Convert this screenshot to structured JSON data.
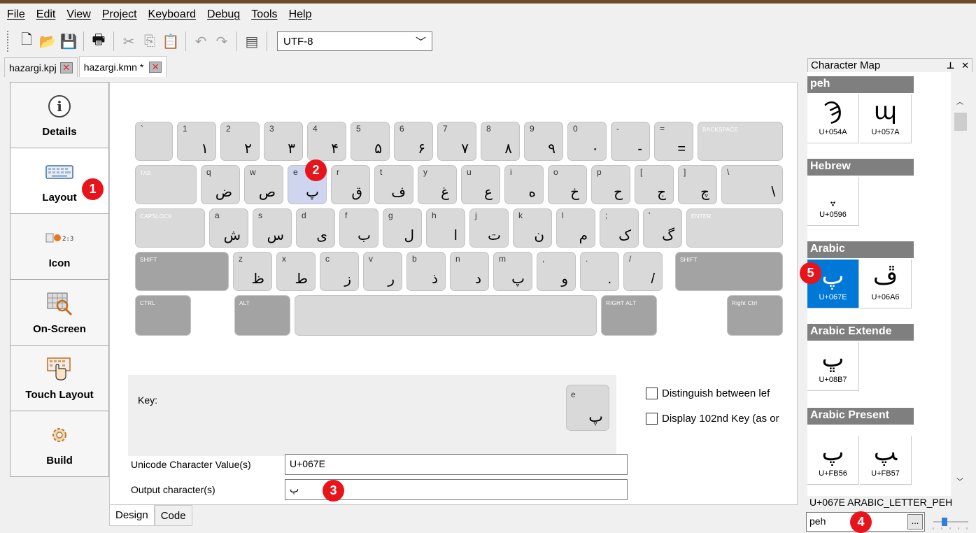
{
  "menu": [
    "File",
    "Edit",
    "View",
    "Project",
    "Keyboard",
    "Debug",
    "Tools",
    "Help"
  ],
  "toolbar": {
    "encoding": "UTF-8"
  },
  "tabs": [
    {
      "label": "hazargi.kpj",
      "active": false
    },
    {
      "label": "hazargi.kmn *",
      "active": true
    }
  ],
  "nav": [
    {
      "label": "Details",
      "icon": "info-icon"
    },
    {
      "label": "Layout",
      "icon": "keyboard-icon"
    },
    {
      "label": "Icon",
      "icon": "icon-editor-icon"
    },
    {
      "label": "On-Screen",
      "icon": "onscreen-keyboard-icon"
    },
    {
      "label": "Touch Layout",
      "icon": "touch-layout-icon"
    },
    {
      "label": "Build",
      "icon": "gear-icon"
    }
  ],
  "keyboard": {
    "rows": [
      [
        {
          "b": "`",
          "o": ""
        },
        {
          "b": "1",
          "o": "١"
        },
        {
          "b": "2",
          "o": "٢"
        },
        {
          "b": "3",
          "o": "٣"
        },
        {
          "b": "4",
          "o": "۴"
        },
        {
          "b": "5",
          "o": "۵"
        },
        {
          "b": "6",
          "o": "۶"
        },
        {
          "b": "7",
          "o": "٧"
        },
        {
          "b": "8",
          "o": "٨"
        },
        {
          "b": "9",
          "o": "٩"
        },
        {
          "b": "0",
          "o": "٠"
        },
        {
          "b": "-",
          "o": "-"
        },
        {
          "b": "=",
          "o": "="
        }
      ],
      [
        {
          "b": "q",
          "o": "ض"
        },
        {
          "b": "w",
          "o": "ص"
        },
        {
          "b": "e",
          "o": "پ"
        },
        {
          "b": "r",
          "o": "ق"
        },
        {
          "b": "t",
          "o": "ف"
        },
        {
          "b": "y",
          "o": "غ"
        },
        {
          "b": "u",
          "o": "ع"
        },
        {
          "b": "i",
          "o": "ه"
        },
        {
          "b": "o",
          "o": "خ"
        },
        {
          "b": "p",
          "o": "ح"
        },
        {
          "b": "[",
          "o": "ج"
        },
        {
          "b": "]",
          "o": "چ"
        },
        {
          "b": "\\",
          "o": "\\"
        }
      ],
      [
        {
          "b": "a",
          "o": "ش"
        },
        {
          "b": "s",
          "o": "س"
        },
        {
          "b": "d",
          "o": "ی"
        },
        {
          "b": "f",
          "o": "ب"
        },
        {
          "b": "g",
          "o": "ل"
        },
        {
          "b": "h",
          "o": "ا"
        },
        {
          "b": "j",
          "o": "ت"
        },
        {
          "b": "k",
          "o": "ن"
        },
        {
          "b": "l",
          "o": "م"
        },
        {
          "b": ";",
          "o": "ک"
        },
        {
          "b": "'",
          "o": "گ"
        }
      ],
      [
        {
          "b": "z",
          "o": "ظ"
        },
        {
          "b": "x",
          "o": "ط"
        },
        {
          "b": "c",
          "o": "ز"
        },
        {
          "b": "v",
          "o": "ر"
        },
        {
          "b": "b",
          "o": "ذ"
        },
        {
          "b": "n",
          "o": "د"
        },
        {
          "b": "m",
          "o": "پ"
        },
        {
          "b": ",",
          "o": "و"
        },
        {
          "b": ".",
          "o": "."
        },
        {
          "b": "/",
          "o": "/"
        }
      ]
    ],
    "mods": {
      "backspace": "BACKSPACE",
      "tab": "TAB",
      "capslock": "CAPSLOCK",
      "enter": "ENTER",
      "shift": "SHIFT",
      "ctrl": "CTRL",
      "alt": "ALT",
      "right_alt": "RIGHT ALT",
      "right_ctrl": "Right Ctrl"
    },
    "selected_key": "e"
  },
  "key_info": {
    "label": "Key:",
    "base": "e",
    "output": "پ"
  },
  "options": {
    "distinguish": "Distinguish between lef",
    "display102": "Display 102nd Key (as or"
  },
  "fields": {
    "unicode_label": "Unicode Character Value(s)",
    "unicode_value": "U+067E",
    "output_label": "Output character(s)",
    "output_value": "پ"
  },
  "editor_tabs": [
    "Design",
    "Code"
  ],
  "charmap": {
    "title": "Character Map",
    "groups": [
      {
        "name": "peh",
        "cells": [
          {
            "g": "Ϡ",
            "c": "U+054A"
          },
          {
            "g": "պ",
            "c": "U+057A"
          }
        ]
      },
      {
        "name": "Hebrew",
        "cells": [
          {
            "g": "ֶ",
            "c": "U+0596"
          }
        ]
      },
      {
        "name": "Arabic",
        "cells": [
          {
            "g": "پ",
            "c": "U+067E"
          },
          {
            "g": "ڦ",
            "c": "U+06A6"
          }
        ]
      },
      {
        "name": "Arabic Extende",
        "cells": [
          {
            "g": "ڀ",
            "c": "U+08B7"
          }
        ]
      },
      {
        "name": "Arabic Present",
        "cells": [
          {
            "g": "ﭖ",
            "c": "U+FB56"
          },
          {
            "g": "ﭗ",
            "c": "U+FB57"
          }
        ]
      }
    ],
    "status": "U+067E ARABIC_LETTER_PEH",
    "search": "peh",
    "more_label": "..."
  },
  "badges": [
    "1",
    "2",
    "3",
    "4",
    "5"
  ]
}
